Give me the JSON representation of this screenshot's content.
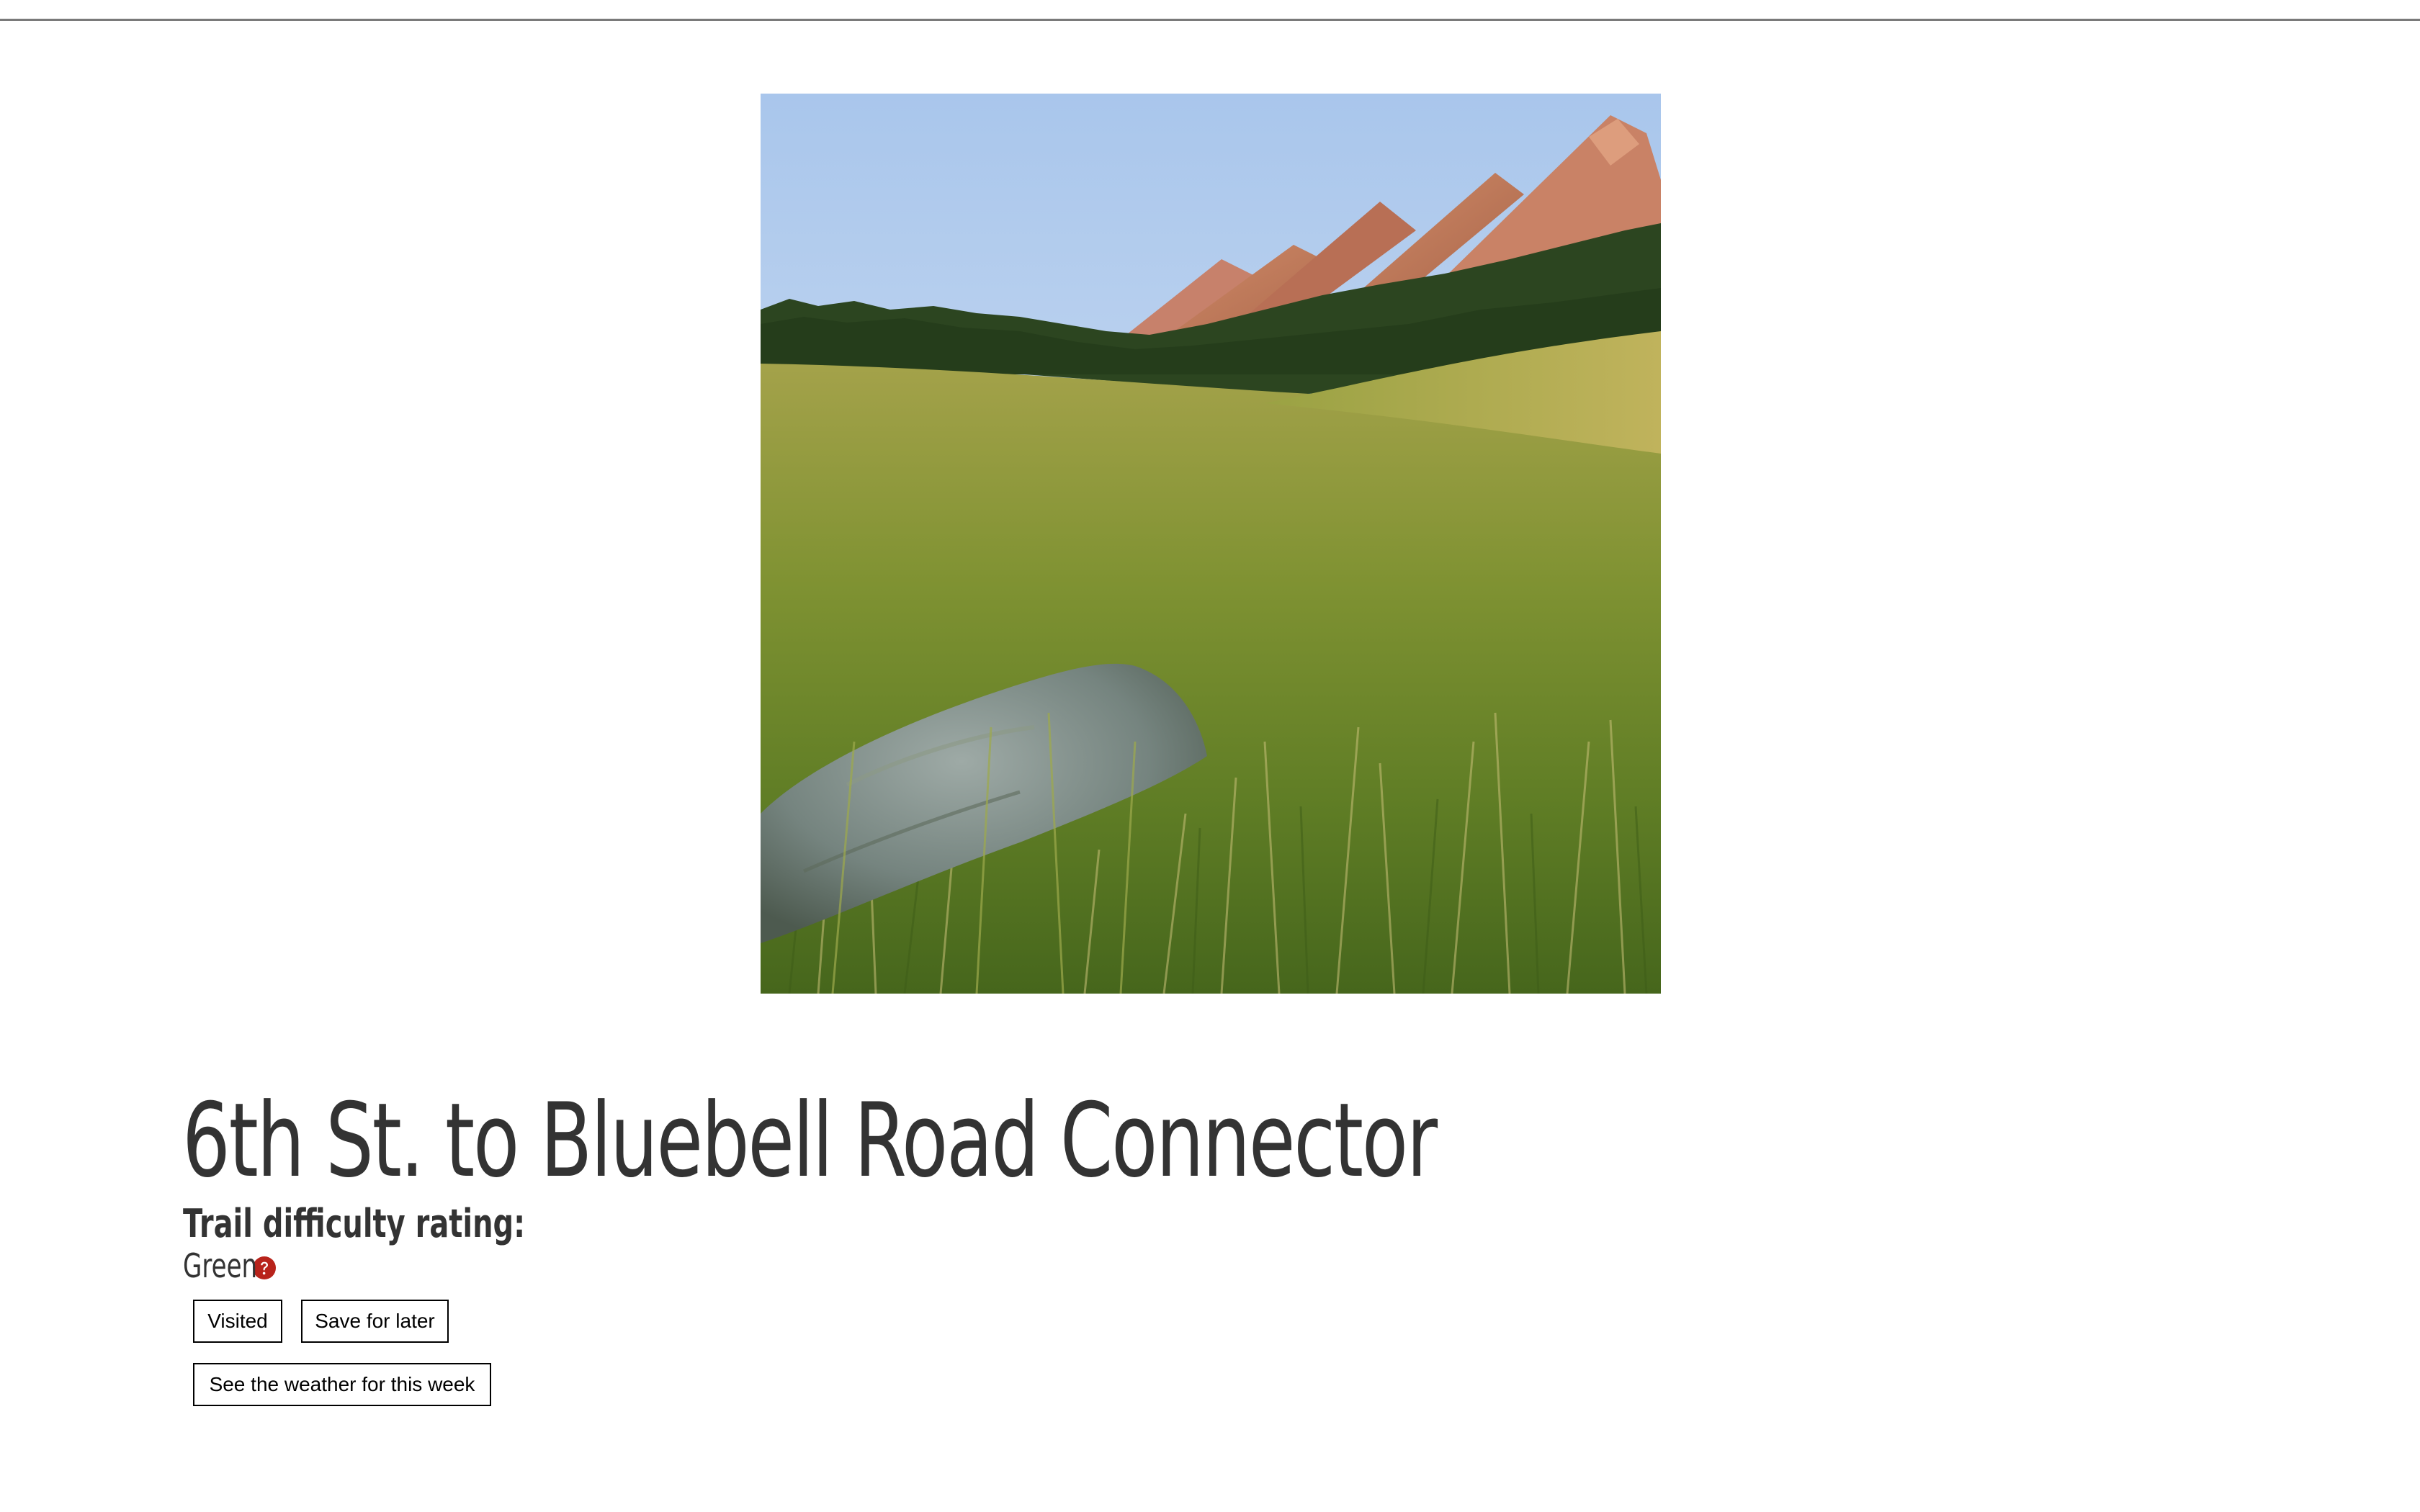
{
  "trail": {
    "name": "6th St. to Bluebell Road Connector",
    "difficulty_heading": "Trail difficulty rating:",
    "difficulty_value": "Green",
    "help_icon": "question-circle-icon",
    "help_icon_color": "#b8231b"
  },
  "photo": {
    "subject": "meadow-with-flatirons",
    "alt": ""
  },
  "actions": {
    "visited_label": "Visited",
    "save_label": "Save for later",
    "weather_label": "See the weather for this week"
  },
  "colors": {
    "text": "#333333",
    "button_border": "#000000",
    "divider": "#7a7a7a"
  }
}
